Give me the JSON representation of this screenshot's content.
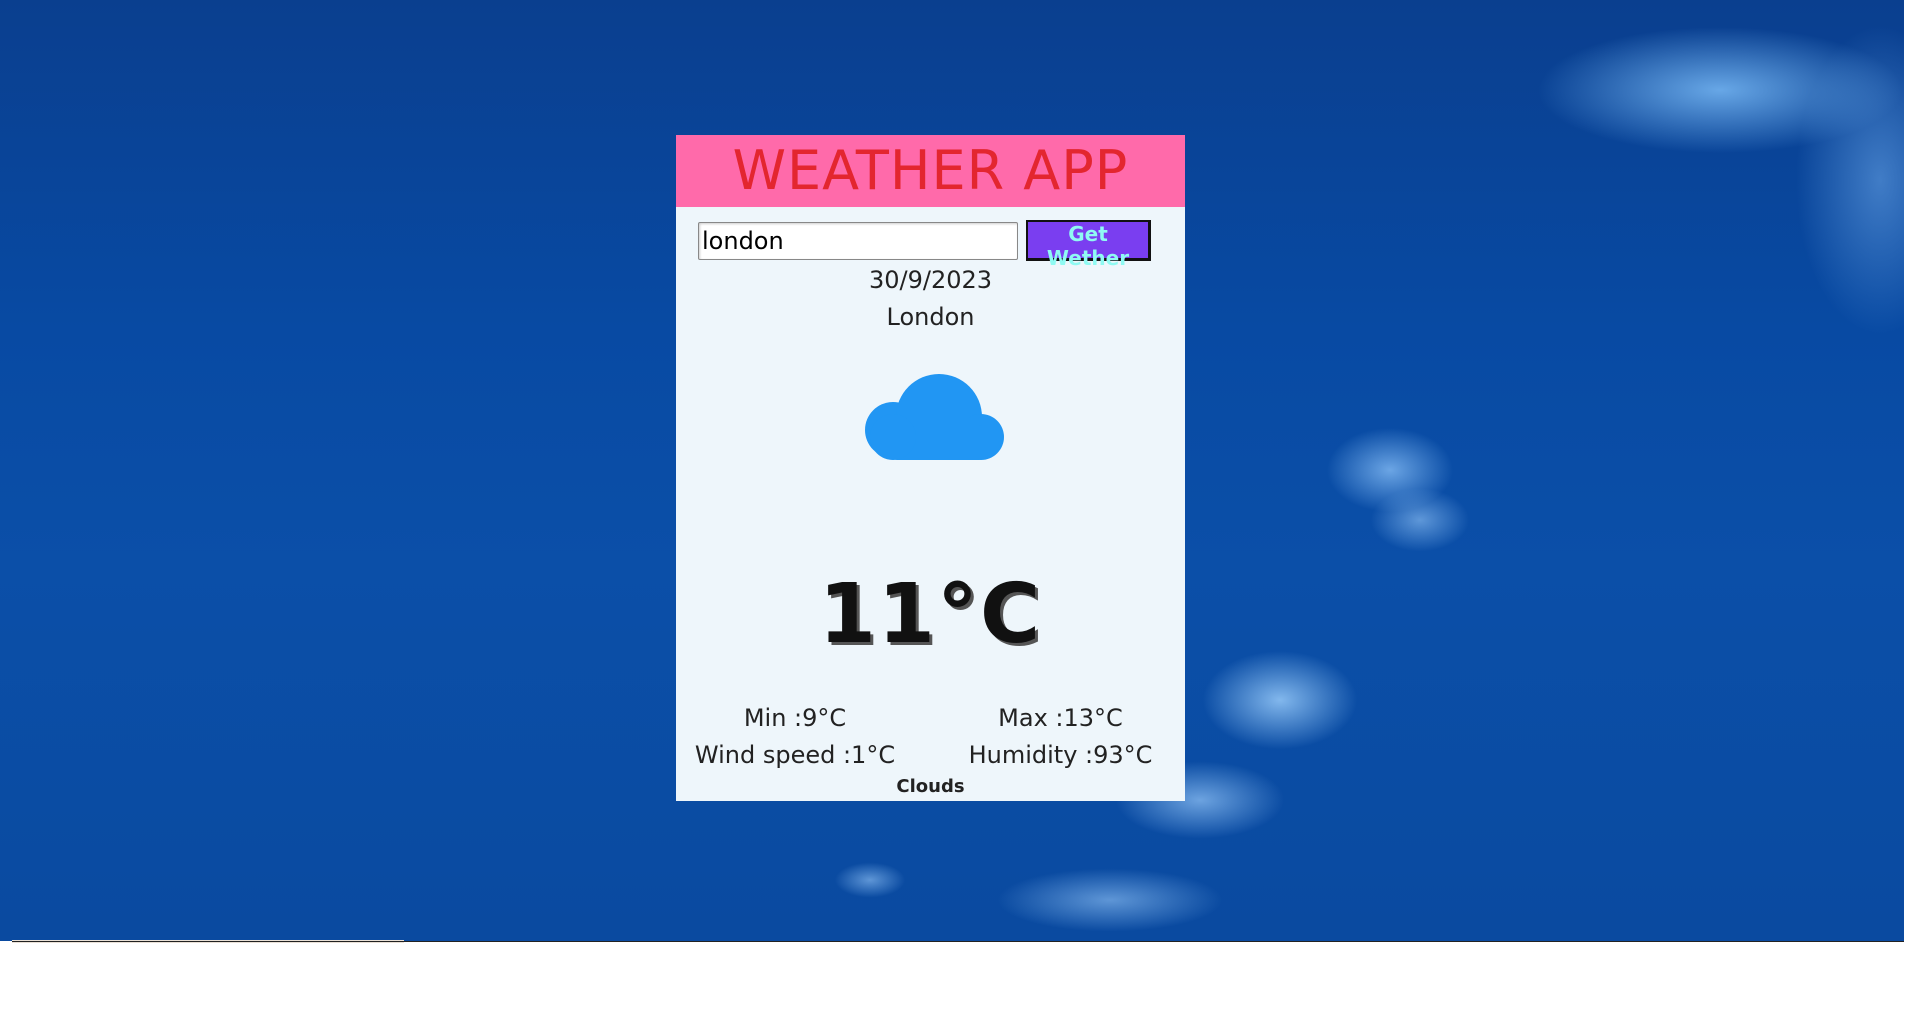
{
  "app": {
    "title": "WEATHER APP"
  },
  "search": {
    "value": "london",
    "button_label": "Get Wether"
  },
  "weather": {
    "date": "30/9/2023",
    "city": "London",
    "icon": "cloud-icon",
    "temperature": "11°C",
    "min": "Min :9°C",
    "max": "Max :13°C",
    "wind": "Wind speed :1°C",
    "humidity": "Humidity :93°C",
    "description": "Clouds"
  },
  "colors": {
    "header_bg": "#ff6aaa",
    "title": "#e3262f",
    "button_bg": "#7a3ef0",
    "button_text": "#8ffaf2",
    "cloud": "#2196f3",
    "card_bg": "#eef6fb"
  }
}
